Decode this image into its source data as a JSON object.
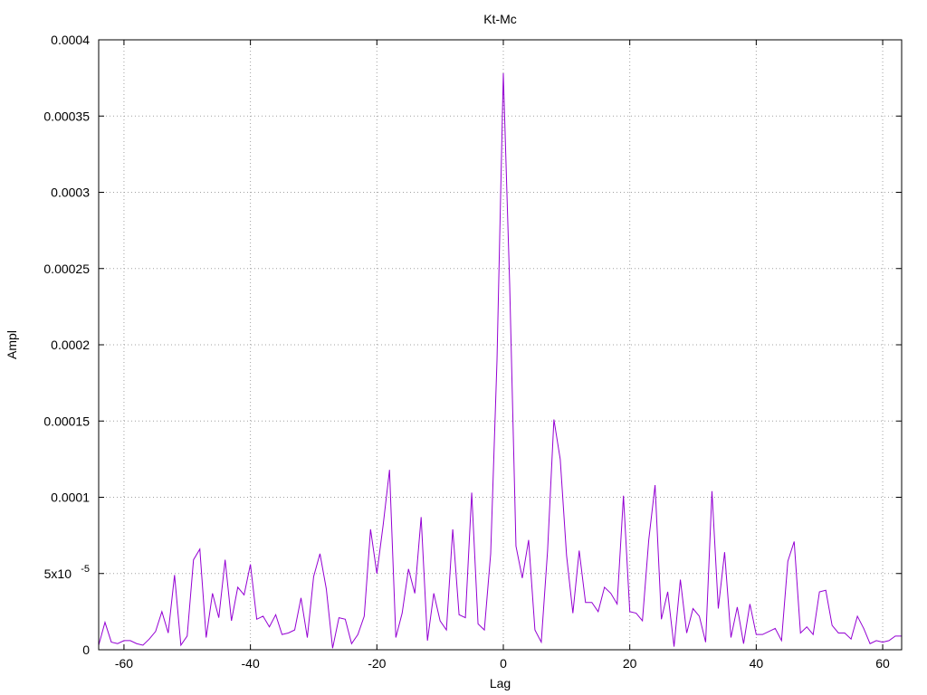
{
  "chart_data": {
    "type": "line",
    "title": "Kt-Mc",
    "xlabel": "Lag",
    "ylabel": "Ampl",
    "xlim": [
      -64,
      63
    ],
    "ylim": [
      0,
      0.0004
    ],
    "grid": true,
    "legend": "none",
    "x_ticks": [
      -60,
      -40,
      -20,
      0,
      20,
      40,
      60
    ],
    "x_tick_labels": [
      "-60",
      "-40",
      "-20",
      "0",
      "20",
      "40",
      "60"
    ],
    "y_ticks": [
      0,
      5e-05,
      0.0001,
      0.00015,
      0.0002,
      0.00025,
      0.0003,
      0.00035,
      0.0004
    ],
    "y_tick_labels": [
      "0",
      "5x10",
      "0.0001",
      "0.00015",
      "0.0002",
      "0.00025",
      "0.0003",
      "0.00035",
      "0.0004"
    ],
    "y_tick_exponent": "-5",
    "series": [
      {
        "color": "#9400d3",
        "x": [
          -64,
          -63,
          -62,
          -61,
          -60,
          -59,
          -58,
          -57,
          -56,
          -55,
          -54,
          -53,
          -52,
          -51,
          -50,
          -49,
          -48,
          -47,
          -46,
          -45,
          -44,
          -43,
          -42,
          -41,
          -40,
          -39,
          -38,
          -37,
          -36,
          -35,
          -34,
          -33,
          -32,
          -31,
          -30,
          -29,
          -28,
          -27,
          -26,
          -25,
          -24,
          -23,
          -22,
          -21,
          -20,
          -19,
          -18,
          -17,
          -16,
          -15,
          -14,
          -13,
          -12,
          -11,
          -10,
          -9,
          -8,
          -7,
          -6,
          -5,
          -4,
          -3,
          -2,
          -1,
          0,
          1,
          2,
          3,
          4,
          5,
          6,
          7,
          8,
          9,
          10,
          11,
          12,
          13,
          14,
          15,
          16,
          17,
          18,
          19,
          20,
          21,
          22,
          23,
          24,
          25,
          26,
          27,
          28,
          29,
          30,
          31,
          32,
          33,
          34,
          35,
          36,
          37,
          38,
          39,
          40,
          41,
          42,
          43,
          44,
          45,
          46,
          47,
          48,
          49,
          50,
          51,
          52,
          53,
          54,
          55,
          56,
          57,
          58,
          59,
          60,
          61,
          62,
          63
        ],
        "y": [
          3e-06,
          1.8e-05,
          5e-06,
          4e-06,
          6e-06,
          6e-06,
          4e-06,
          3e-06,
          7e-06,
          1.2e-05,
          2.5e-05,
          1.1e-05,
          4.9e-05,
          3e-06,
          9e-06,
          5.9e-05,
          6.6e-05,
          8e-06,
          3.7e-05,
          2.1e-05,
          5.9e-05,
          1.9e-05,
          4.1e-05,
          3.6e-05,
          5.6e-05,
          2e-05,
          2.2e-05,
          1.5e-05,
          2.3e-05,
          1e-05,
          1.1e-05,
          1.3e-05,
          3.4e-05,
          8e-06,
          4.8e-05,
          6.3e-05,
          4e-05,
          1e-06,
          2.1e-05,
          2e-05,
          4e-06,
          1e-05,
          2.2e-05,
          7.9e-05,
          5e-05,
          8.2e-05,
          0.000118,
          8e-06,
          2.4e-05,
          5.3e-05,
          3.7e-05,
          8.7e-05,
          6e-06,
          3.7e-05,
          1.9e-05,
          1.3e-05,
          7.9e-05,
          2.3e-05,
          2.1e-05,
          0.000103,
          1.7e-05,
          1.3e-05,
          6.3e-05,
          0.00019,
          0.000378,
          0.00024,
          6.8e-05,
          4.7e-05,
          7.2e-05,
          1.3e-05,
          5e-06,
          6.5e-05,
          0.000151,
          0.000125,
          6.2e-05,
          2.4e-05,
          6.5e-05,
          3.1e-05,
          3.1e-05,
          2.5e-05,
          4.1e-05,
          3.7e-05,
          3e-05,
          0.000101,
          2.5e-05,
          2.4e-05,
          1.9e-05,
          7.2e-05,
          0.000108,
          2e-05,
          3.8e-05,
          2e-06,
          4.6e-05,
          1.1e-05,
          2.7e-05,
          2.2e-05,
          5e-06,
          0.000104,
          2.7e-05,
          6.4e-05,
          8e-06,
          2.8e-05,
          4e-06,
          3e-05,
          1e-05,
          1e-05,
          1.2e-05,
          1.4e-05,
          6e-06,
          5.8e-05,
          7.1e-05,
          1.1e-05,
          1.5e-05,
          1e-05,
          3.8e-05,
          3.9e-05,
          1.6e-05,
          1.1e-05,
          1.1e-05,
          7e-06,
          2.2e-05,
          1.4e-05,
          4e-06,
          6e-06,
          5e-06,
          6e-06,
          9e-06,
          9e-06
        ]
      }
    ]
  }
}
